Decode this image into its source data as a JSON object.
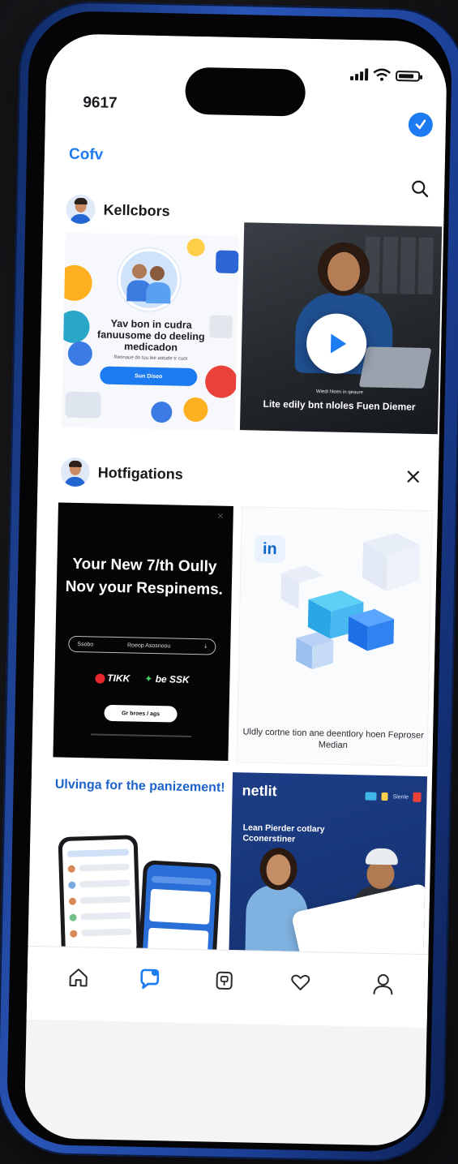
{
  "status_bar": {
    "time": "9617"
  },
  "header": {
    "brand": "Cofv"
  },
  "sections": [
    {
      "title": "Kellcbors"
    },
    {
      "title": "Hotfigations"
    }
  ],
  "cards": {
    "infographic": {
      "title": "Yav bon in cudra fanuusome do deeling medicadon",
      "subtitle": "Reonaue do tuu lee aotude tr cuot",
      "cta": "Sun Diseo"
    },
    "video": {
      "caption_small": "Wiedi hleen in qeaure",
      "caption": "Lite edily bnt nloles Fuen Diemer"
    },
    "promo_black": {
      "headline": "Your New 7/th Oully Nov your Respinems.",
      "input_left": "Ssobo",
      "input_right": "Roeop Asosnoou",
      "logo1": "TIKK",
      "logo2": "be SSK",
      "button": "Gr broes / ags"
    },
    "linkedin": {
      "logo": "in",
      "caption": "Uldly cortne tion ane deentlory hoen Feproser Median"
    },
    "apps": {
      "headline": "Ulvinga for the panizement!"
    },
    "netlit": {
      "brand": "netlit",
      "tag_text": "Slenle",
      "headline": "Lean Pierder cotlary Cconerstiner"
    }
  },
  "tabs": [
    {
      "name": "home"
    },
    {
      "name": "messages"
    },
    {
      "name": "pages"
    },
    {
      "name": "likes"
    },
    {
      "name": "profile"
    }
  ],
  "colors": {
    "accent": "#1d7bf2",
    "phone_frame": "#2a55b8",
    "linkedin_blue": "#0a66c2"
  }
}
